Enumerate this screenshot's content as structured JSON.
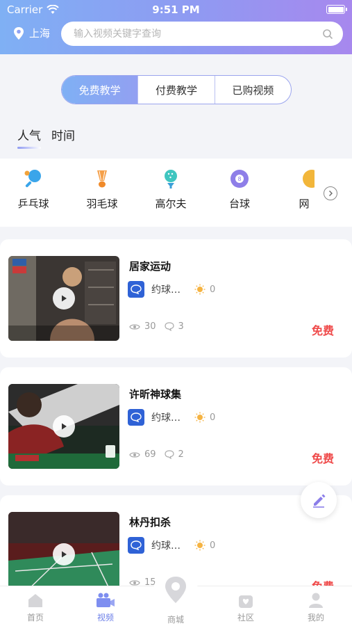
{
  "status_bar": {
    "carrier": "Carrier",
    "time": "9:51 PM"
  },
  "header": {
    "city": "上海",
    "search_placeholder": "输入视频关键字查询"
  },
  "segments": [
    {
      "label": "免费教学",
      "active": true
    },
    {
      "label": "付费教学",
      "active": false
    },
    {
      "label": "已购视频",
      "active": false
    }
  ],
  "sort_tabs": [
    {
      "label": "人气",
      "active": true
    },
    {
      "label": "时间",
      "active": false
    }
  ],
  "categories": [
    {
      "label": "乒乓球",
      "icon": "ping-pong-icon"
    },
    {
      "label": "羽毛球",
      "icon": "badminton-icon"
    },
    {
      "label": "高尔夫",
      "icon": "golf-icon"
    },
    {
      "label": "台球",
      "icon": "billiards-icon"
    },
    {
      "label": "网",
      "icon": "tennis-icon"
    }
  ],
  "videos": [
    {
      "title": "居家运动",
      "author": "约球…",
      "likes": "0",
      "views": "30",
      "comments": "3",
      "price": "免费"
    },
    {
      "title": "许昕神球集",
      "author": "约球…",
      "likes": "0",
      "views": "69",
      "comments": "2",
      "price": "免费"
    },
    {
      "title": "林丹扣杀",
      "author": "约球…",
      "likes": "0",
      "views": "15",
      "comments": "",
      "price": "免费"
    }
  ],
  "nav": [
    {
      "label": "首页"
    },
    {
      "label": "视频"
    },
    {
      "label": "商城"
    },
    {
      "label": "社区"
    },
    {
      "label": "我的"
    }
  ],
  "colors": {
    "accent": "#6c7fe8",
    "price": "#ef4a4a",
    "header_start": "#7fb0f4",
    "header_end": "#a788ee"
  }
}
